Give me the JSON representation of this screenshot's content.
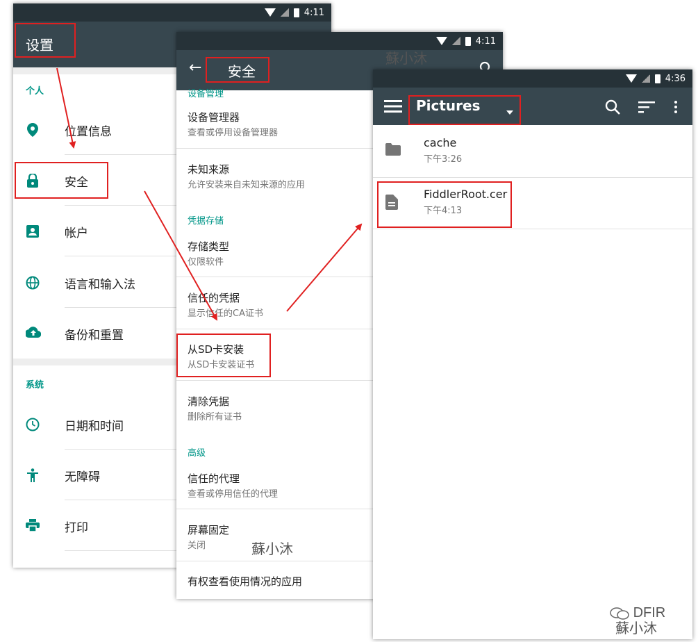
{
  "screen1": {
    "time": "4:11",
    "title": "设置",
    "section_personal": "个人",
    "items_personal": [
      {
        "label": "位置信息",
        "icon": "location-icon"
      },
      {
        "label": "安全",
        "icon": "lock-icon"
      },
      {
        "label": "帐户",
        "icon": "account-icon"
      },
      {
        "label": "语言和输入法",
        "icon": "globe-icon"
      },
      {
        "label": "备份和重置",
        "icon": "cloud-upload-icon"
      }
    ],
    "section_system": "系统",
    "items_system": [
      {
        "label": "日期和时间",
        "icon": "clock-icon"
      },
      {
        "label": "无障碍",
        "icon": "accessibility-icon"
      },
      {
        "label": "打印",
        "icon": "print-icon"
      }
    ]
  },
  "screen2": {
    "time": "4:11",
    "title": "安全",
    "cat_device_admin": "设备管理",
    "items": [
      {
        "title": "设备管理器",
        "subtitle": "查看或停用设备管理器"
      },
      {
        "title": "未知来源",
        "subtitle": "允许安装来自未知来源的应用"
      },
      {
        "title": "存储类型",
        "subtitle": "仅限软件"
      },
      {
        "title": "信任的凭据",
        "subtitle": "显示信任的CA证书"
      },
      {
        "title": "从SD卡安装",
        "subtitle": "从SD卡安装证书"
      },
      {
        "title": "清除凭据",
        "subtitle": "删除所有证书"
      },
      {
        "title": "信任的代理",
        "subtitle": "查看或停用信任的代理"
      },
      {
        "title": "屏幕固定",
        "subtitle": "关闭"
      },
      {
        "title": "有权查看使用情况的应用",
        "subtitle": ""
      }
    ],
    "cat_credentials": "凭据存储",
    "cat_advanced": "高级"
  },
  "screen3": {
    "time": "4:36",
    "title": "Pictures",
    "files": [
      {
        "name": "cache",
        "time": "下午3:26",
        "icon": "folder-icon"
      },
      {
        "name": "FiddlerRoot.cer",
        "time": "下午4:13",
        "icon": "document-icon"
      }
    ]
  },
  "watermarks": {
    "wm1": "蘇小沐",
    "wm2": "蘇小沐",
    "wm3": "DFIR",
    "wm4": "蘇小沐"
  },
  "colors": {
    "appbar": "#37474f",
    "statusbar": "#263238",
    "accent": "#009688",
    "highlight": "#e02020"
  }
}
